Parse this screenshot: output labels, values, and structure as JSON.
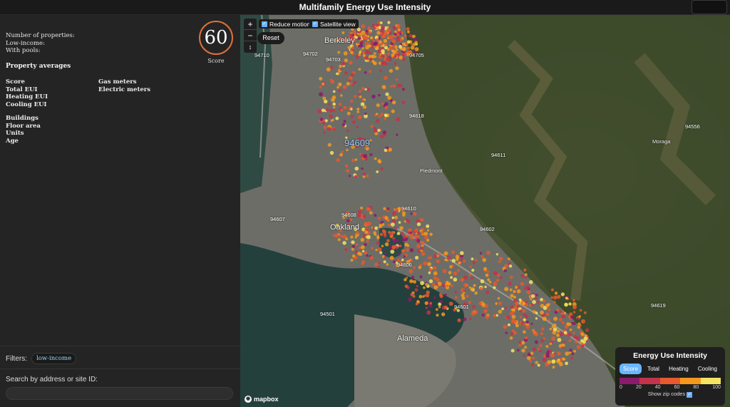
{
  "app": {
    "title": "Multifamily Energy Use Intensity"
  },
  "sidebar": {
    "stats": [
      "Number of properties:",
      "Low-income:",
      "With pools:"
    ],
    "score": {
      "value": "60",
      "label": "Score"
    },
    "averages_heading": "Property averages",
    "col1": [
      "Score",
      "Total EUI",
      "Heating EUI",
      "Cooling EUI"
    ],
    "col2": [
      "Gas meters",
      "Electric meters"
    ],
    "col3": [
      "Buildings",
      "Floor area",
      "Units",
      "Age"
    ],
    "filters_label": "Filters:",
    "filter_chip": "low-income",
    "search_label": "Search by address or site ID:",
    "search_value": ""
  },
  "map": {
    "controls": {
      "zoom_in": "+",
      "zoom_out": "−",
      "compass": "↕"
    },
    "reduce_motion": "Reduce motion",
    "satellite_view": "Satellite view",
    "reset": "Reset",
    "attribution": "mapbox",
    "zip_labels": [
      "94710",
      "94702",
      "94703",
      "94705",
      "94618",
      "94609",
      "94611",
      "94608",
      "94610",
      "94607",
      "94602",
      "94606",
      "94601",
      "94501",
      "94619",
      "94556"
    ],
    "place_labels": [
      "Berkeley",
      "Oakland",
      "Moraga",
      "Alameda",
      "Piedmont"
    ]
  },
  "legend": {
    "title": "Energy Use Intensity",
    "tabs": [
      "Score",
      "Total",
      "Heating",
      "Cooling"
    ],
    "active_tab": "Score",
    "colors": [
      "#8b1a6b",
      "#c3334a",
      "#e8592e",
      "#f39a1c",
      "#f5e462"
    ],
    "ticks": [
      "0",
      "20",
      "40",
      "60",
      "80",
      "100"
    ],
    "show_zip": "Show zip codes"
  }
}
